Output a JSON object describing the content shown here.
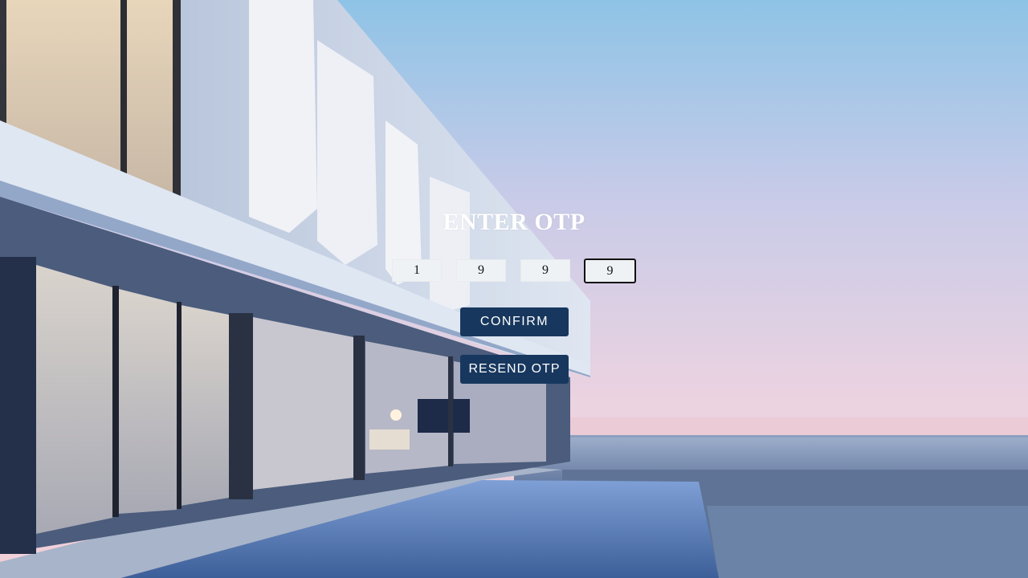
{
  "page": {
    "title": "ENTER OTP"
  },
  "otp": {
    "digits": [
      "1",
      "9",
      "9",
      "9"
    ],
    "focused_index": 3
  },
  "actions": {
    "confirm_label": "CONFIRM",
    "resend_label": "RESEND OTP"
  },
  "colors": {
    "button_bg": "#17375e",
    "title_text": "#ffffff",
    "input_bg": "#eef2f4"
  },
  "background": {
    "description_icon": "modern-villa-with-pool-photo"
  }
}
